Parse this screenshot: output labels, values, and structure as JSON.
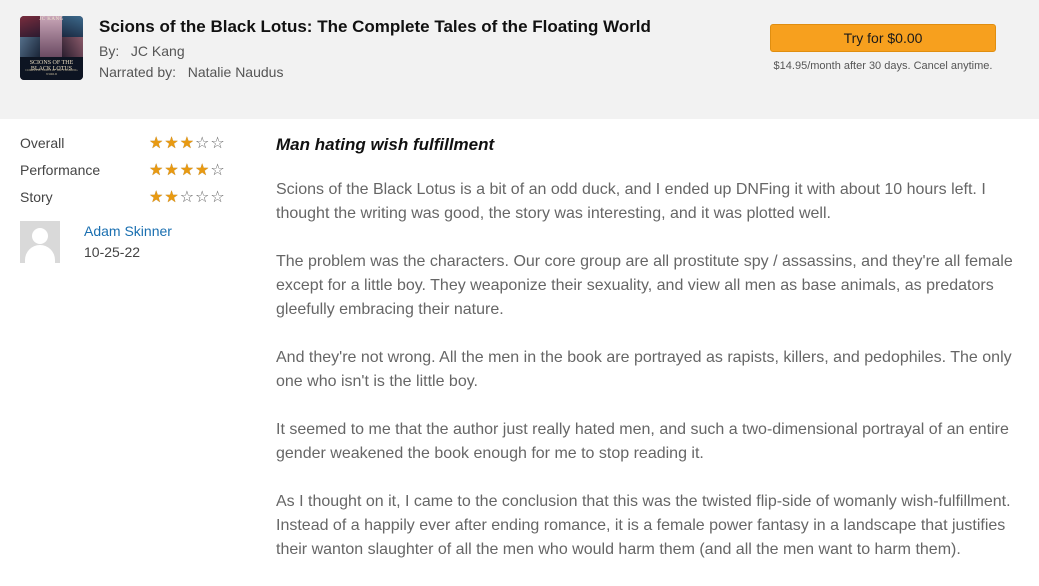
{
  "book": {
    "title": "Scions of the Black Lotus: The Complete Tales of the Floating World",
    "by_label": "By:",
    "author": "JC Kang",
    "narrated_label": "Narrated by:",
    "narrator": "Natalie Naudus",
    "cover": {
      "author_text": "JC KANG",
      "title_text": "SCIONS OF THE BLACK LOTUS",
      "subtitle_text": "COMPLETE TALES OF THE FLOATING WORLD"
    }
  },
  "offer": {
    "button_label": "Try for $0.00",
    "terms": "$14.95/month after 30 days. Cancel anytime.",
    "accent_color": "#f7a01e"
  },
  "ratings": [
    {
      "label": "Overall",
      "stars": 3,
      "max": 5
    },
    {
      "label": "Performance",
      "stars": 4,
      "max": 5
    },
    {
      "label": "Story",
      "stars": 2,
      "max": 5
    }
  ],
  "reviewer": {
    "name": "Adam Skinner",
    "date": "10-25-22",
    "avatar_icon": "default-user-avatar-icon"
  },
  "review": {
    "title": "Man hating wish fulfillment",
    "paragraphs": [
      "Scions of the Black Lotus is a bit of an odd duck, and I ended up DNFing it with about 10 hours left. I thought the writing was good, the story was interesting, and it was plotted well.",
      "The problem was the characters. Our core group are all prostitute spy / assassins, and they're all female except for a little boy. They weaponize their sexuality, and view all men as base animals, as predators gleefully embracing their nature.",
      "And they're not wrong. All the men in the book are portrayed as rapists, killers, and pedophiles. The only one who isn't is the little boy.",
      "It seemed to me that the author just really hated men, and such a two-dimensional portrayal of an entire gender weakened the book enough for me to stop reading it.",
      "As I thought on it, I came to the conclusion that this was the twisted flip-side of womanly wish-fulfillment. Instead of a happily ever after ending romance, it is a female power fantasy in a landscape that justifies their wanton slaughter of all the men who would harm them (and all the men want to harm them)."
    ]
  }
}
